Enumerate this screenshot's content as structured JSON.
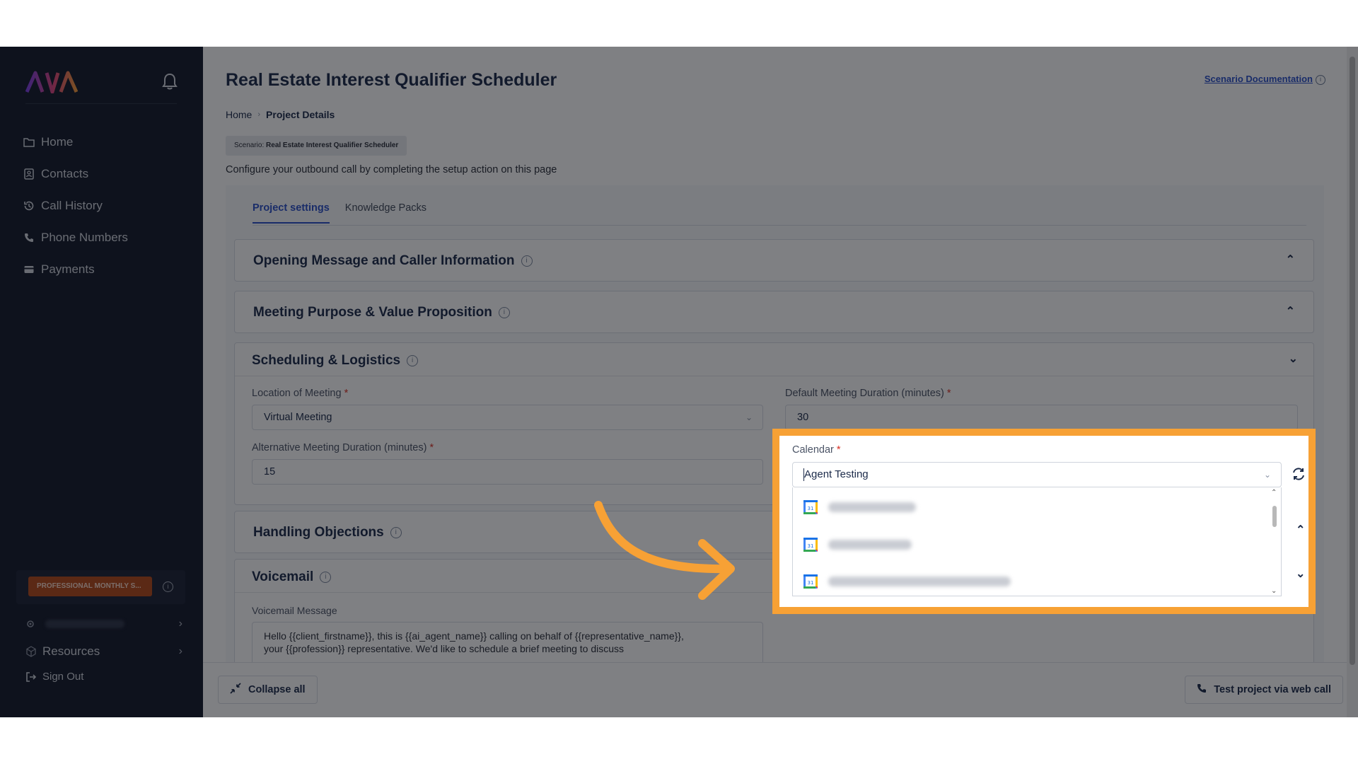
{
  "sidebar": {
    "logo_text": "AVA",
    "nav": [
      {
        "label": "Home",
        "icon": "folder-icon"
      },
      {
        "label": "Contacts",
        "icon": "contacts-icon"
      },
      {
        "label": "Call History",
        "icon": "history-icon"
      },
      {
        "label": "Phone Numbers",
        "icon": "phone-icon"
      },
      {
        "label": "Payments",
        "icon": "payments-icon"
      }
    ],
    "plan_badge": "PROFESSIONAL MONTHLY S...",
    "resources_label": "Resources",
    "signout_label": "Sign Out"
  },
  "header": {
    "title": "Real Estate Interest Qualifier Scheduler",
    "doc_link": "Scenario Documentation",
    "breadcrumb_home": "Home",
    "breadcrumb_current": "Project Details",
    "scenario_prefix": "Scenario:",
    "scenario_name": "Real Estate Interest Qualifier Scheduler",
    "config_text": "Configure your outbound call by completing the setup action on this page"
  },
  "tabs": [
    "Project settings",
    "Knowledge Packs"
  ],
  "sections": {
    "opening": "Opening Message and Caller Information",
    "purpose": "Meeting Purpose & Value Proposition",
    "scheduling": "Scheduling & Logistics",
    "objections": "Handling Objections",
    "voicemail": "Voicemail"
  },
  "fields": {
    "location_label": "Location of Meeting",
    "location_value": "Virtual Meeting",
    "duration_label": "Default Meeting Duration (minutes)",
    "duration_value": "30",
    "alt_duration_label": "Alternative Meeting Duration (minutes)",
    "alt_duration_value": "15",
    "calendar_label": "Calendar",
    "calendar_value": "Agent Testing",
    "required_mark": "*",
    "voicemail_label": "Voicemail Message",
    "voicemail_line1": "Hello {{client_firstname}}, this is {{ai_agent_name}} calling on behalf of {{representative_name}},",
    "voicemail_line2": "your {{profession}} representative. We'd like to schedule a brief meeting to discuss"
  },
  "buttons": {
    "collapse_all": "Collapse all",
    "test_call": "Test project via web call"
  },
  "colors": {
    "highlight": "#f7a135",
    "sidebar_bg": "#13192a",
    "accent": "#2a50c8",
    "plan_badge": "#b5491a"
  }
}
